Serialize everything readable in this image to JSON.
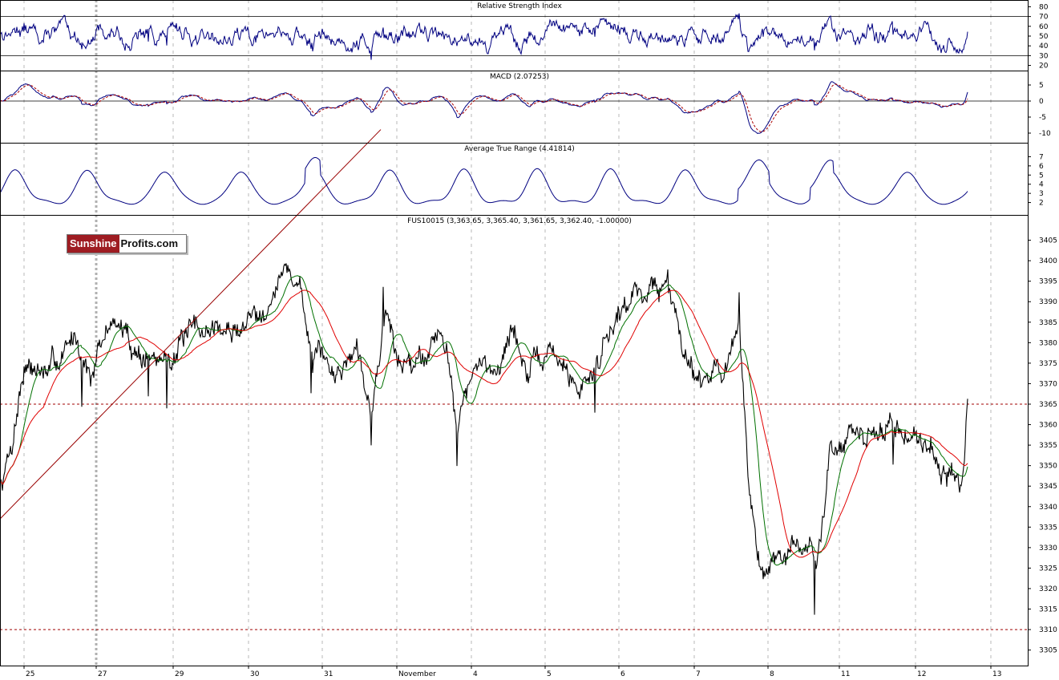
{
  "logo": {
    "part1": "Sunshine",
    "part2": "Profits.com"
  },
  "chart_data": [
    {
      "type": "line",
      "title": "Relative Strength Index",
      "yticks": [
        20,
        30,
        40,
        50,
        60,
        70,
        80
      ],
      "ylim": [
        18,
        82
      ],
      "reference_lines": [
        30,
        70
      ],
      "series": [
        {
          "color": "#000080"
        }
      ]
    },
    {
      "type": "line",
      "title": "MACD (2.07253)",
      "yticks": [
        -10,
        -5,
        0,
        5
      ],
      "ylim": [
        -12,
        8
      ],
      "reference_lines": [
        0
      ],
      "series": [
        {
          "color": "#000080"
        },
        {
          "color": "#aa0000",
          "dashed": true
        }
      ]
    },
    {
      "type": "line",
      "title": "Average True Range (4.41814)",
      "yticks": [
        2,
        3,
        4,
        5,
        6,
        7
      ],
      "ylim": [
        1,
        8
      ],
      "series": [
        {
          "color": "#000080"
        }
      ]
    },
    {
      "type": "line",
      "title": "FUS10015 (3,363.65, 3,365.40, 3,361.65, 3,362.40, -1.00000)",
      "yticks": [
        3305,
        3310,
        3315,
        3320,
        3325,
        3330,
        3335,
        3340,
        3345,
        3350,
        3355,
        3360,
        3365,
        3370,
        3375,
        3380,
        3385,
        3390,
        3395,
        3400,
        3405
      ],
      "ylim": [
        3302,
        3410
      ],
      "reference_lines": [
        3365,
        3310
      ],
      "x_tick_labels": [
        "25",
        "27",
        "29",
        "30",
        "31",
        "November",
        "4",
        "5",
        "6",
        "7",
        "8",
        "11",
        "12",
        "13"
      ],
      "price_anchors": [
        [
          0,
          3345
        ],
        [
          15,
          3356
        ],
        [
          30,
          3375
        ],
        [
          60,
          3372
        ],
        [
          95,
          3382
        ],
        [
          115,
          3372
        ],
        [
          140,
          3386
        ],
        [
          170,
          3378
        ],
        [
          200,
          3375
        ],
        [
          225,
          3380
        ],
        [
          265,
          3384
        ],
        [
          290,
          3382
        ],
        [
          330,
          3390
        ],
        [
          360,
          3398
        ],
        [
          375,
          3393
        ],
        [
          390,
          3376
        ],
        [
          420,
          3372
        ],
        [
          445,
          3380
        ],
        [
          465,
          3366
        ],
        [
          480,
          3388
        ],
        [
          500,
          3374
        ],
        [
          530,
          3378
        ],
        [
          550,
          3385
        ],
        [
          570,
          3362
        ],
        [
          590,
          3372
        ],
        [
          620,
          3375
        ],
        [
          640,
          3383
        ],
        [
          660,
          3372
        ],
        [
          690,
          3378
        ],
        [
          720,
          3368
        ],
        [
          745,
          3375
        ],
        [
          760,
          3385
        ],
        [
          790,
          3392
        ],
        [
          820,
          3394
        ],
        [
          835,
          3392
        ],
        [
          850,
          3382
        ],
        [
          870,
          3372
        ],
        [
          900,
          3374
        ],
        [
          922,
          3380
        ],
        [
          935,
          3345
        ],
        [
          950,
          3322
        ],
        [
          970,
          3328
        ],
        [
          990,
          3328
        ],
        [
          1010,
          3330
        ],
        [
          1020,
          3325
        ],
        [
          1035,
          3355
        ],
        [
          1060,
          3357
        ],
        [
          1085,
          3356
        ],
        [
          1110,
          3360
        ],
        [
          1130,
          3358
        ],
        [
          1160,
          3356
        ],
        [
          1180,
          3348
        ],
        [
          1200,
          3346
        ],
        [
          1207,
          3363
        ]
      ],
      "series": [
        {
          "name": "",
          "color": "#000000"
        },
        {
          "name": "",
          "color": "#007000"
        },
        {
          "name": "",
          "color": "#e00000"
        }
      ],
      "trendline": {
        "from": [
          0,
          3337
        ],
        "to": [
          475,
          3432
        ],
        "color": "#990000"
      }
    }
  ]
}
